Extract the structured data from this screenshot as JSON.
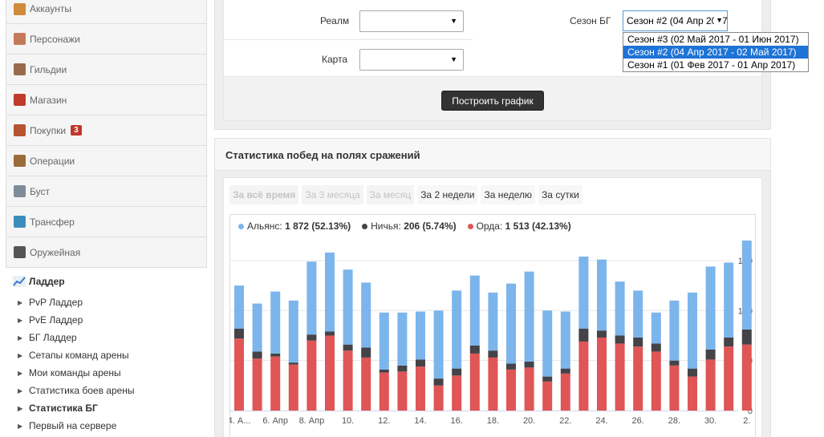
{
  "sidebar": {
    "items": [
      {
        "label": "Аккаунты",
        "icon": "user-icon",
        "color": "#d08a3c"
      },
      {
        "label": "Персонажи",
        "icon": "users-icon",
        "color": "#c47a5a"
      },
      {
        "label": "Гильдии",
        "icon": "shirt-icon",
        "color": "#9a6a4e"
      },
      {
        "label": "Магазин",
        "icon": "shop-icon",
        "color": "#c0392b"
      },
      {
        "label": "Покупки",
        "icon": "cart-icon",
        "color": "#b5542f",
        "badge": "3"
      },
      {
        "label": "Операции",
        "icon": "wallet-icon",
        "color": "#9b6b3a"
      },
      {
        "label": "Буст",
        "icon": "rocket-icon",
        "color": "#7f8c9a"
      },
      {
        "label": "Трансфер",
        "icon": "transfer-icon",
        "color": "#3c8dbc"
      },
      {
        "label": "Оружейная",
        "icon": "armory-icon",
        "color": "#555555"
      }
    ],
    "ladder": {
      "title": "Ладдер",
      "items": [
        {
          "label": "PvP Ладдер"
        },
        {
          "label": "PvE Ладдер"
        },
        {
          "label": "БГ Ладдер"
        },
        {
          "label": "Сетапы команд арены"
        },
        {
          "label": "Мои команды арены"
        },
        {
          "label": "Статистика боев арены"
        },
        {
          "label": "Статистика БГ",
          "active": true
        },
        {
          "label": "Первый на сервере"
        }
      ]
    }
  },
  "form": {
    "realm_label": "Реалм",
    "map_label": "Карта",
    "season_label": "Сезон БГ",
    "season_value": "Сезон #2 (04 Апр 2017 - 02 Май 2017)",
    "season_options": [
      "Сезон #3 (02 Май 2017 - 01 Июн 2017)",
      "Сезон #2 (04 Апр 2017 - 02 Май 2017)",
      "Сезон #1 (01 Фев 2017 - 01 Апр 2017)"
    ],
    "build_button": "Построить график"
  },
  "stats": {
    "title": "Статистика побед на полях сражений",
    "tabs": [
      "За всё время",
      "За 3 месяца",
      "За месяц",
      "За 2 недели",
      "За неделю",
      "За сутки"
    ],
    "legend": [
      {
        "name": "Альянс:",
        "value": "1 872 (52.13%)",
        "color": "#7cb5ec"
      },
      {
        "name": "Ничья:",
        "value": "206 (5.74%)",
        "color": "#434348"
      },
      {
        "name": "Орда:",
        "value": "1 513 (42.13%)",
        "color": "#e05555"
      }
    ]
  },
  "chart_data": {
    "type": "bar",
    "stacked": true,
    "ylim": [
      0,
      170
    ],
    "yticks": [
      0,
      50,
      100,
      150
    ],
    "xtick_labels": [
      "4. А...",
      "6. Апр",
      "8. Апр",
      "10.",
      "12.",
      "14.",
      "16.",
      "18.",
      "20.",
      "22.",
      "24.",
      "26.",
      "28.",
      "30.",
      "2."
    ],
    "series": [
      {
        "name": "Орда",
        "color": "#e05555",
        "values": [
          72,
          52,
          54,
          46,
          70,
          75,
          60,
          53,
          38,
          39,
          44,
          25,
          35,
          57,
          53,
          41,
          43,
          29,
          37,
          69,
          73,
          67,
          64,
          59,
          45,
          34,
          51,
          64,
          66
        ]
      },
      {
        "name": "Ничья",
        "color": "#434348",
        "values": [
          10,
          7,
          3,
          2,
          6,
          4,
          6,
          10,
          3,
          6,
          7,
          7,
          7,
          8,
          7,
          6,
          6,
          5,
          5,
          13,
          7,
          8,
          9,
          8,
          5,
          8,
          10,
          9,
          15
        ]
      },
      {
        "name": "Альянс",
        "color": "#7cb5ec",
        "values": [
          43,
          48,
          62,
          62,
          73,
          79,
          75,
          65,
          57,
          53,
          48,
          68,
          78,
          70,
          58,
          80,
          90,
          66,
          57,
          72,
          71,
          54,
          47,
          31,
          60,
          76,
          83,
          75,
          90
        ]
      }
    ]
  }
}
